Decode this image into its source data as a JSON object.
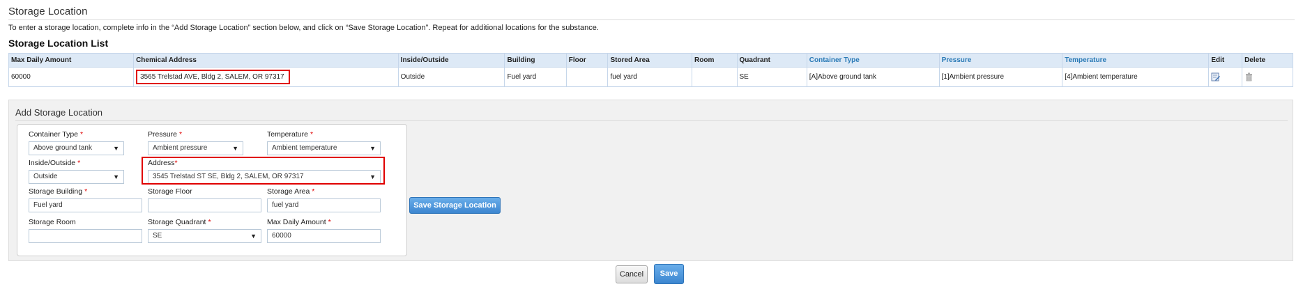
{
  "header": {
    "title": "Storage Location",
    "instructions": "To enter a storage location, complete info in the “Add Storage Location” section below, and click on “Save Storage Location”. Repeat for additional locations for the substance.",
    "list_title": "Storage Location List"
  },
  "table": {
    "columns": [
      "Max Daily Amount",
      "Chemical Address",
      "Inside/Outside",
      "Building",
      "Floor",
      "Stored Area",
      "Room",
      "Quadrant",
      "Container Type",
      "Pressure",
      "Temperature",
      "Edit",
      "Delete"
    ],
    "rows": [
      {
        "max_daily_amount": "60000",
        "chemical_address": "3565 Trelstad AVE, Bldg 2, SALEM, OR 97317",
        "inside_outside": "Outside",
        "building": "Fuel yard",
        "floor": "",
        "stored_area": "fuel yard",
        "room": "",
        "quadrant": "SE",
        "container_type": "[A]Above ground tank",
        "pressure": "[1]Ambient pressure",
        "temperature": "[4]Ambient temperature",
        "edit_icon": "edit-icon",
        "delete_icon": "trash-icon"
      }
    ]
  },
  "add_form": {
    "title": "Add Storage Location",
    "container_type": {
      "label": "Container Type",
      "value": "Above ground tank"
    },
    "pressure": {
      "label": "Pressure",
      "value": "Ambient pressure"
    },
    "temperature": {
      "label": "Temperature",
      "value": "Ambient temperature"
    },
    "inside_outside": {
      "label": "Inside/Outside",
      "value": "Outside"
    },
    "address": {
      "label": "Address",
      "value": "3545 Trelstad ST SE, Bldg 2, SALEM, OR 97317"
    },
    "storage_building": {
      "label": "Storage Building",
      "value": "Fuel yard"
    },
    "storage_floor": {
      "label": "Storage Floor",
      "value": ""
    },
    "storage_area": {
      "label": "Storage Area",
      "value": "fuel yard"
    },
    "storage_room": {
      "label": "Storage Room",
      "value": ""
    },
    "storage_quadrant": {
      "label": "Storage Quadrant",
      "value": "SE"
    },
    "max_daily_amount": {
      "label": "Max Daily Amount",
      "value": "60000"
    },
    "required_marker": "*",
    "save_location_label": "Save Storage Location"
  },
  "footer": {
    "cancel_label": "Cancel",
    "save_label": "Save"
  },
  "colors": {
    "accent": "#3c86d0",
    "header_bg": "#dde9f6",
    "highlight": "#e00000",
    "link": "#2a7ab6"
  }
}
